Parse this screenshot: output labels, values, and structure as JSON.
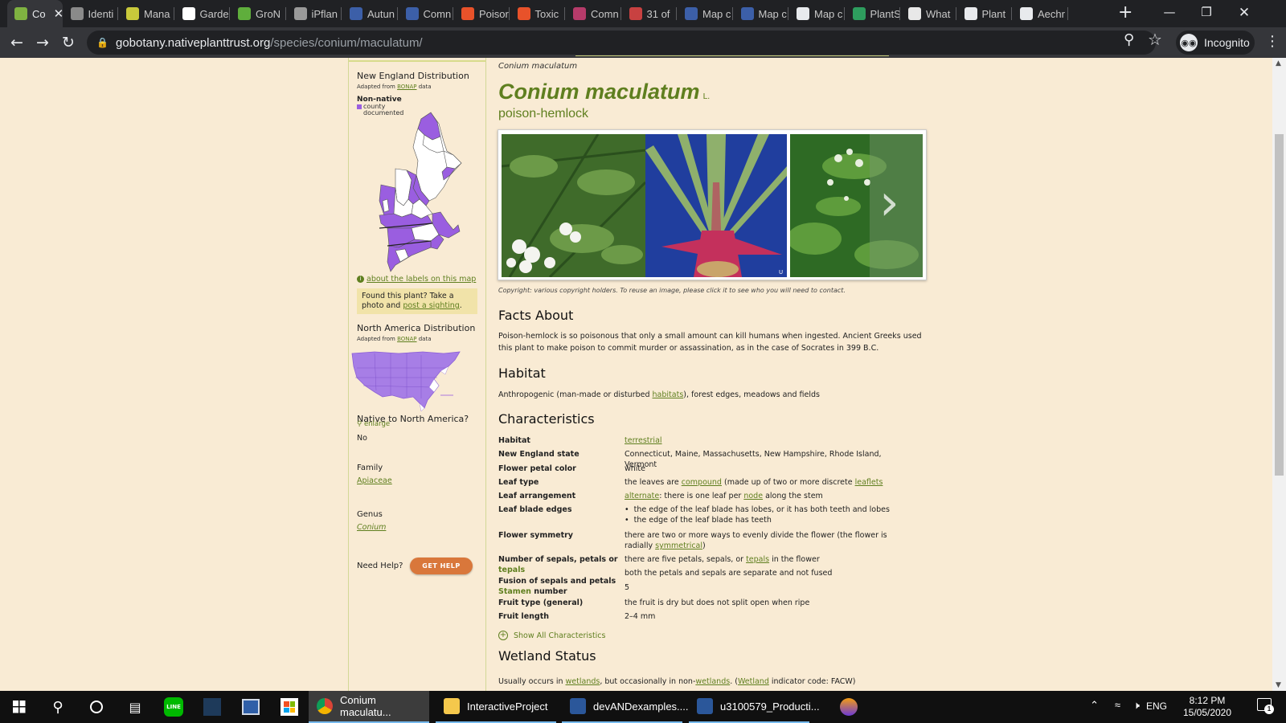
{
  "browser": {
    "tabs": [
      {
        "title": "Co",
        "icon": "leaf-icon",
        "color": "#7fb241",
        "active": true
      },
      {
        "title": "Identi",
        "icon": "globe-photo-icon",
        "color": "#8a8a8a"
      },
      {
        "title": "Mana",
        "icon": "lemon-icon",
        "color": "#c9c93b"
      },
      {
        "title": "Garde",
        "icon": "google-icon",
        "color": "#ffffff"
      },
      {
        "title": "GroN",
        "icon": "sprout-icon",
        "color": "#5fae3c"
      },
      {
        "title": "iPflan",
        "icon": "photo-icon",
        "color": "#9a9a9a"
      },
      {
        "title": "Autun",
        "icon": "flower-icon",
        "color": "#3c5fa8"
      },
      {
        "title": "Comn",
        "icon": "flower-icon",
        "color": "#3c5fa8"
      },
      {
        "title": "Poisor",
        "icon": "leaf-badge-icon",
        "color": "#e8522a"
      },
      {
        "title": "Toxic",
        "icon": "aspca-icon",
        "color": "#e8522a"
      },
      {
        "title": "Comn",
        "icon": "grid-icon",
        "color": "#b63b6a"
      },
      {
        "title": "31 of",
        "icon": "list-icon",
        "color": "#c84141"
      },
      {
        "title": "Map c",
        "icon": "map-icon",
        "color": "#3c5fa8"
      },
      {
        "title": "Map c",
        "icon": "map-icon",
        "color": "#3c5fa8"
      },
      {
        "title": "Map c",
        "icon": "compass-icon",
        "color": "#e8eaed"
      },
      {
        "title": "PlantS",
        "icon": "plants-icon",
        "color": "#2e9d5e"
      },
      {
        "title": "What",
        "icon": "daisy-icon",
        "color": "#e8e8e8"
      },
      {
        "title": "Plant",
        "icon": "infinity-icon",
        "color": "#e8eaed"
      },
      {
        "title": "Aechr",
        "icon": "infinity-icon",
        "color": "#e8eaed"
      }
    ],
    "url_host": "gobotany.nativeplanttrust.org",
    "url_path": "/species/conium/maculatum/",
    "incognito_label": "Incognito"
  },
  "sidebar": {
    "ne_title": "New England Distribution",
    "adapted_prefix": "Adapted from ",
    "bonap": "BONAP",
    "adapted_suffix": " data",
    "nonnative": "Non-native",
    "county_documented": "county documented",
    "labels_link": "about the labels on this map",
    "found_prefix": "Found this plant? Take a photo and ",
    "post_sighting": "post a sighting",
    "found_suffix": ".",
    "na_title": "North America Distribution",
    "native_q": "Native to North America?",
    "enlarge": "enlarge",
    "native_a": "No",
    "family_label": "Family",
    "family_value": "Apiaceae",
    "genus_label": "Genus",
    "genus_value": "Conium",
    "help_label": "Need Help?",
    "get_help": "GET HELP"
  },
  "species": {
    "breadcrumb": "Conium maculatum",
    "scientific_name": "Conium maculatum",
    "author": "L.",
    "common_name": "poison-hemlock",
    "copyright": "Copyright: various copyright holders. To reuse an image, please click it to see who you will need to contact."
  },
  "facts": {
    "heading": "Facts About",
    "text": "Poison-hemlock is so poisonous that only a small amount can kill humans when ingested. Ancient Greeks used this plant to make poison to commit murder or assassination, as in the case of Socrates in 399 B.C."
  },
  "habitat": {
    "heading": "Habitat",
    "prefix": "Anthropogenic (man-made or disturbed ",
    "link": "habitats",
    "suffix": "), forest edges, meadows and fields"
  },
  "characteristics": {
    "heading": "Characteristics",
    "habitat_k": "Habitat",
    "habitat_v": "terrestrial",
    "state_k": "New England state",
    "state_v": "Connecticut, Maine, Massachusetts, New Hampshire, Rhode Island, Vermont",
    "petal_k": "Flower petal color",
    "petal_v": "white",
    "leaftype_k": "Leaf type",
    "leaftype_v1": "the leaves are ",
    "leaftype_l1": "compound",
    "leaftype_v2": " (made up of two or more discrete ",
    "leaftype_l2": "leaflets",
    "leafarr_k": "Leaf arrangement",
    "leafarr_l1": "alternate",
    "leafarr_v1": ": there is one leaf per ",
    "leafarr_l2": "node",
    "leafarr_v2": " along the stem",
    "edges_k": "Leaf blade edges",
    "edges_v1": "the edge of the leaf blade has lobes, or it has both teeth and lobes",
    "edges_v2": "the edge of the leaf blade has teeth",
    "sym_k": "Flower symmetry",
    "sym_v1": "there are two or more ways to evenly divide the flower (the flower is radially ",
    "sym_l": "symmetrical",
    "sym_v2": ")",
    "num_k1": "Number of sepals, petals or ",
    "num_kl": "tepals",
    "num_v1": "there are five petals, sepals, or ",
    "num_vl": "tepals",
    "num_v2": " in the flower",
    "fusion_k": "Fusion of sepals and petals",
    "fusion_v": "both the petals and sepals are separate and not fused",
    "stamen_kl": "Stamen",
    "stamen_k": " number",
    "stamen_v": "5",
    "fruit_k": "Fruit type (general)",
    "fruit_v": "the fruit is dry but does not split open when ripe",
    "flen_k": "Fruit length",
    "flen_v": "2–4 mm",
    "show_all": "Show All Characteristics"
  },
  "wetland": {
    "heading": "Wetland Status",
    "t1": "Usually occurs in ",
    "l1": "wetlands",
    "t2": ", but occasionally in non-",
    "l2": "wetlands",
    "t3": ". (",
    "l3": "Wetland",
    "t4": " indicator code: FACW)"
  },
  "taskbar": {
    "apps": [
      {
        "label": "Conium maculatu...",
        "icon": "chrome-icon",
        "active": true
      },
      {
        "label": "InteractiveProject",
        "icon": "folder-icon",
        "active": false
      },
      {
        "label": "devANDexamples....",
        "icon": "word-icon",
        "active": false
      },
      {
        "label": "u3100579_Producti...",
        "icon": "word-icon",
        "active": false
      }
    ],
    "lang": "ENG",
    "time": "8:12 PM",
    "date": "15/05/2020",
    "notif_count": "1"
  }
}
